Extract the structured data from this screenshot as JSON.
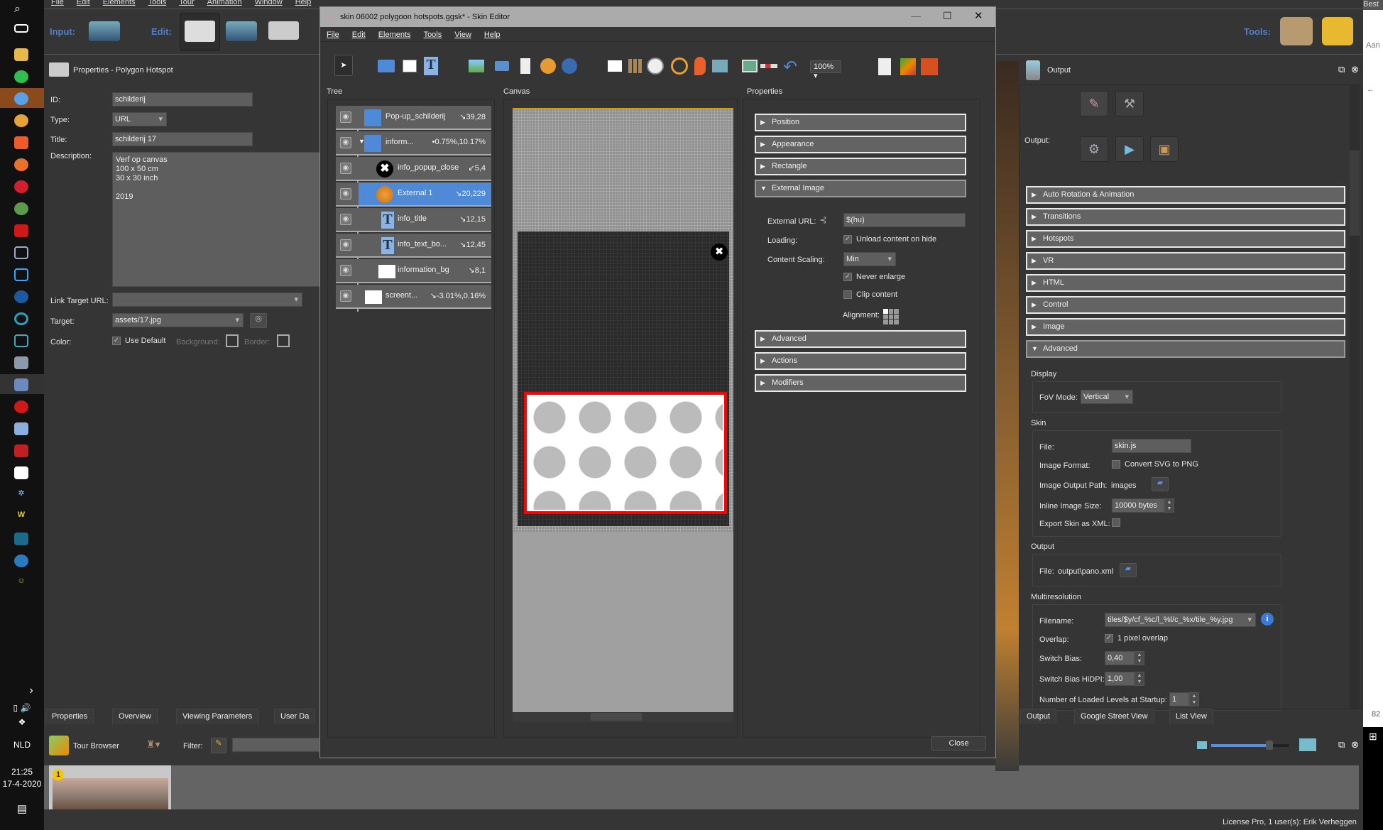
{
  "taskbar": {
    "lang": "NLD",
    "time": "21:25",
    "date": "17-4-2020"
  },
  "main_menu": [
    "File",
    "Edit",
    "Elements",
    "Tools",
    "Tour",
    "Animation",
    "Window",
    "Help"
  ],
  "toolbar": {
    "input_label": "Input:",
    "edit_label": "Edit:",
    "tools_label": "Tools:"
  },
  "left_panel": {
    "title": "Properties - Polygon Hotspot",
    "id_label": "ID:",
    "id_value": "schilderij",
    "type_label": "Type:",
    "type_value": "URL",
    "title_label": "Title:",
    "title_value": "schilderij 17",
    "description_label": "Description:",
    "description_lines": [
      "Verf op canvas",
      "100 x 50 cm",
      "30 x 30 inch",
      "",
      "2019"
    ],
    "link_target_label": "Link Target URL:",
    "link_target_value": "",
    "target_label": "Target:",
    "target_value": "assets/17.jpg",
    "color_label": "Color:",
    "use_default_label": "Use Default",
    "use_default_checked": true,
    "background_label": "Background:",
    "border_label": "Border:"
  },
  "bottom_tabs": [
    "Properties",
    "Overview",
    "Viewing Parameters",
    "User Da"
  ],
  "tour_browser": {
    "title": "Tour Browser",
    "filter_label": "Filter:",
    "filter_value": "",
    "thumbnail_badge": "1"
  },
  "status_bar": "License Pro, 1 user(s): Erik Verheggen",
  "skin_editor": {
    "title": "skin 06002 polygoon hotspots.ggsk* - Skin Editor",
    "menu": [
      "File",
      "Edit",
      "Elements",
      "Tools",
      "View",
      "Help"
    ],
    "zoom": "100%",
    "tree_label": "Tree",
    "canvas_label": "Canvas",
    "properties_label": "Properties",
    "tree": [
      {
        "name": "Pop-up_schilderij",
        "coords": "↘39,28",
        "icon": "folder-icon",
        "indent": 0
      },
      {
        "name": "inform...",
        "coords": "•0.75%,10.17%",
        "icon": "folder-icon",
        "indent": 0,
        "expanded": true
      },
      {
        "name": "info_popup_close",
        "coords": "↙5,4",
        "icon": "close-button-icon",
        "indent": 1
      },
      {
        "name": "External 1",
        "coords": "↘20,229",
        "icon": "globe-icon",
        "indent": 1,
        "selected": true
      },
      {
        "name": "info_title",
        "coords": "↘12,15",
        "icon": "text-icon",
        "indent": 1
      },
      {
        "name": "info_text_bo...",
        "coords": "↘12,45",
        "icon": "text-icon",
        "indent": 1
      },
      {
        "name": "information_bg",
        "coords": "↘8,1",
        "icon": "rectangle-icon",
        "indent": 1
      },
      {
        "name": "screent...",
        "coords": "↘-3.01%,0.16%",
        "icon": "rectangle-icon",
        "indent": 0
      }
    ],
    "sections_top": [
      "Position",
      "Appearance",
      "Rectangle"
    ],
    "external_image": {
      "header": "External Image",
      "url_label": "External URL:",
      "url_value": "$(hu)",
      "loading_label": "Loading:",
      "unload_label": "Unload content on hide",
      "unload_checked": true,
      "scaling_label": "Content Scaling:",
      "scaling_value": "Min",
      "never_enlarge_label": "Never enlarge",
      "never_enlarge_checked": true,
      "clip_label": "Clip content",
      "clip_checked": false,
      "alignment_label": "Alignment:"
    },
    "sections_bottom": [
      "Advanced",
      "Actions",
      "Modifiers"
    ],
    "close_label": "Close"
  },
  "output_panel": {
    "title": "Output",
    "output_label": "Output:",
    "sections": [
      "Auto Rotation & Animation",
      "Transitions",
      "Hotspots",
      "VR",
      "HTML",
      "Control",
      "Image"
    ],
    "advanced_label": "Advanced",
    "display": {
      "label": "Display",
      "fov_label": "FoV Mode:",
      "fov_value": "Vertical"
    },
    "skin": {
      "label": "Skin",
      "file_label": "File:",
      "file_value": "skin.js",
      "format_label": "Image Format:",
      "convert_label": "Convert SVG to PNG",
      "path_label": "Image Output Path:",
      "path_value": "images",
      "inline_label": "Inline Image Size:",
      "inline_value": "10000 bytes",
      "xml_label": "Export Skin as XML:"
    },
    "output": {
      "label": "Output",
      "file_label": "File:",
      "file_value": "output\\pano.xml"
    },
    "multires": {
      "label": "Multiresolution",
      "filename_label": "Filename:",
      "filename_value": "tiles/$y/cf_%c/l_%l/c_%x/tile_%y.jpg",
      "overlap_label": "Overlap:",
      "overlap_text": "1 pixel overlap",
      "overlap_checked": true,
      "bias_label": "Switch Bias:",
      "bias_value": "0,40",
      "hidpi_label": "Switch Bias HiDPI:",
      "hidpi_value": "1,00",
      "levels_label": "Number of Loaded Levels at Startup:",
      "levels_value": "1"
    },
    "tabs": [
      "Output",
      "Google Street View",
      "List View"
    ]
  },
  "side_strip": {
    "top": "Best",
    "label": "Aan",
    "number": "82"
  },
  "colors": {
    "accent": "#4f8ad8",
    "background": "#353535",
    "selection_red": "#ff0000",
    "label_blue": "#4f7fcf"
  }
}
